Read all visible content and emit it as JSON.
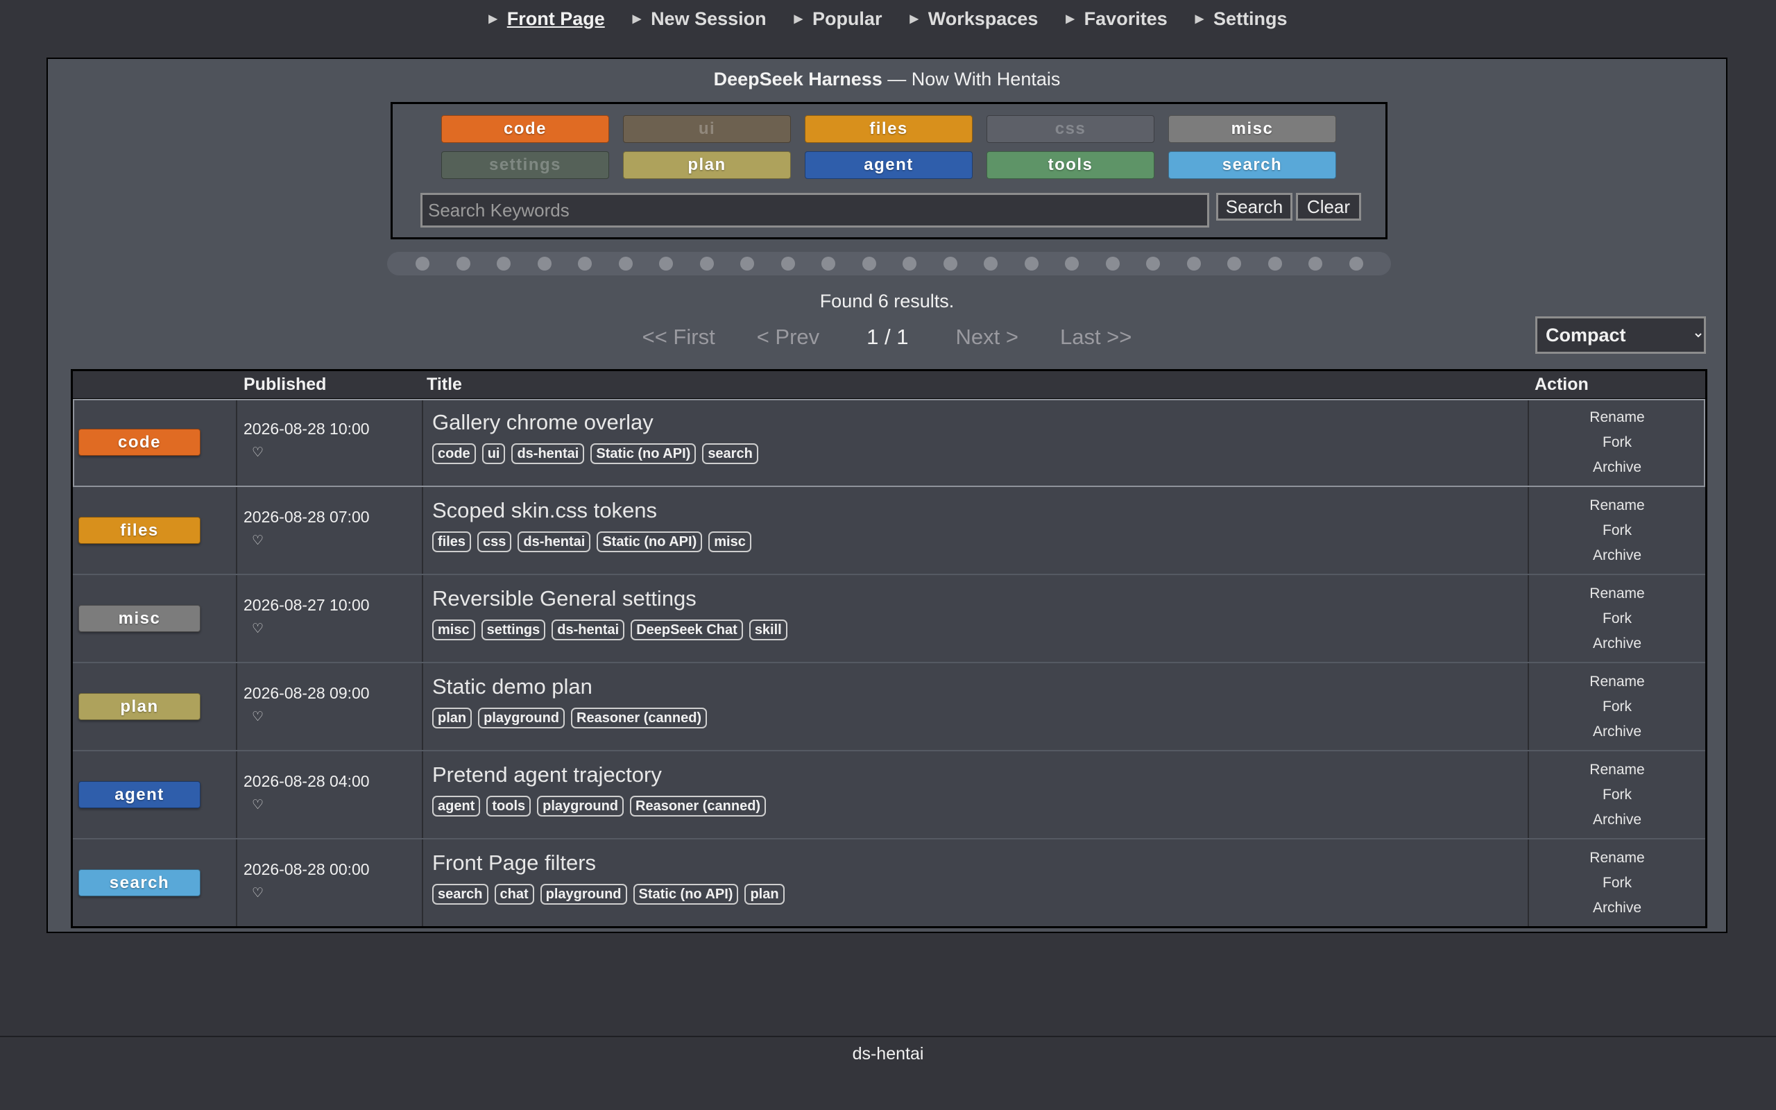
{
  "nav": {
    "items": [
      {
        "label": "Front Page"
      },
      {
        "label": "New Session"
      },
      {
        "label": "Popular"
      },
      {
        "label": "Workspaces"
      },
      {
        "label": "Favorites"
      },
      {
        "label": "Settings"
      }
    ]
  },
  "site": {
    "title_bold": "DeepSeek Harness",
    "title_rest": " — Now With Hentais"
  },
  "categories": [
    {
      "label": "code",
      "color": "#e06b23",
      "active": true
    },
    {
      "label": "ui",
      "color": "#6d6150",
      "active": false
    },
    {
      "label": "files",
      "color": "#d8901c",
      "active": true
    },
    {
      "label": "css",
      "color": "#5d6068",
      "active": false
    },
    {
      "label": "misc",
      "color": "#7c7c7c",
      "active": true
    },
    {
      "label": "settings",
      "color": "#556158",
      "active": false
    },
    {
      "label": "plan",
      "color": "#aea25c",
      "active": true
    },
    {
      "label": "agent",
      "color": "#2f5eab",
      "active": true
    },
    {
      "label": "tools",
      "color": "#5e9467",
      "active": true
    },
    {
      "label": "search",
      "color": "#59a8d8",
      "active": true
    }
  ],
  "search": {
    "placeholder": "Search Keywords",
    "value": "",
    "search_label": "Search",
    "clear_label": "Clear"
  },
  "results": {
    "found_text": "Found 6 results.",
    "pager": {
      "first": "<< First",
      "prev": "< Prev",
      "current": "1 / 1",
      "next": "Next >",
      "last": "Last >>"
    },
    "view_mode": "Compact"
  },
  "table": {
    "headers": {
      "published": "Published",
      "title": "Title",
      "action": "Action"
    },
    "rows": [
      {
        "category": "code",
        "cat_color": "#e06b23",
        "published": "2026-08-28 10:00",
        "title": "Gallery chrome overlay",
        "tags": [
          "code",
          "ui",
          "ds-hentai",
          "Static (no API)",
          "search"
        ]
      },
      {
        "category": "files",
        "cat_color": "#d8901c",
        "published": "2026-08-28 07:00",
        "title": "Scoped skin.css tokens",
        "tags": [
          "files",
          "css",
          "ds-hentai",
          "Static (no API)",
          "misc"
        ]
      },
      {
        "category": "misc",
        "cat_color": "#7c7c7c",
        "published": "2026-08-27 10:00",
        "title": "Reversible General settings",
        "tags": [
          "misc",
          "settings",
          "ds-hentai",
          "DeepSeek Chat",
          "skill"
        ]
      },
      {
        "category": "plan",
        "cat_color": "#aea25c",
        "published": "2026-08-28 09:00",
        "title": "Static demo plan",
        "tags": [
          "plan",
          "playground",
          "Reasoner (canned)"
        ]
      },
      {
        "category": "agent",
        "cat_color": "#2f5eab",
        "published": "2026-08-28 04:00",
        "title": "Pretend agent trajectory",
        "tags": [
          "agent",
          "tools",
          "playground",
          "Reasoner (canned)"
        ]
      },
      {
        "category": "search",
        "cat_color": "#59a8d8",
        "published": "2026-08-28 00:00",
        "title": "Front Page filters",
        "tags": [
          "search",
          "chat",
          "playground",
          "Static (no API)",
          "plan"
        ]
      }
    ],
    "actions": [
      "Rename",
      "Fork",
      "Archive"
    ],
    "favorite_glyph": "♡"
  },
  "footer": {
    "text": "ds-hentai"
  }
}
